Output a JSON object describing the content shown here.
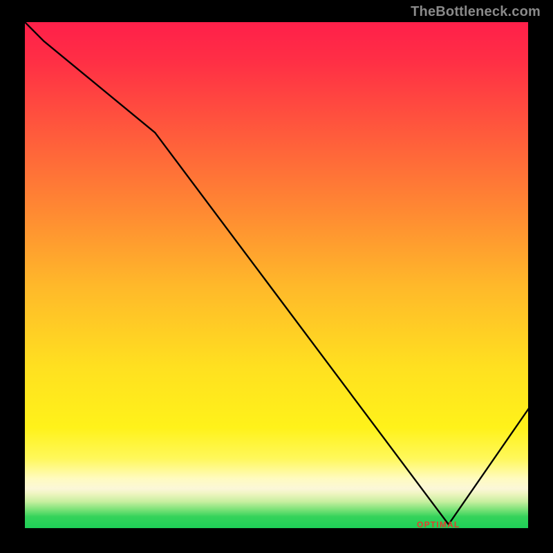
{
  "watermark": "TheBottleneck.com",
  "optimal_label": "OPTIMAL",
  "chart_data": {
    "type": "line",
    "title": "",
    "xlabel": "",
    "ylabel": "",
    "xlim": [
      0,
      100
    ],
    "ylim": [
      0,
      100
    ],
    "x": [
      0,
      4,
      26,
      84,
      100
    ],
    "y": [
      100,
      96,
      78,
      1,
      24
    ],
    "optimal_x": 82,
    "optimal_y": 1,
    "gradient_stops": [
      {
        "pos": 0,
        "color": "#ff1f4a"
      },
      {
        "pos": 22,
        "color": "#ff5a3c"
      },
      {
        "pos": 52,
        "color": "#ffb82a"
      },
      {
        "pos": 80,
        "color": "#fff21a"
      },
      {
        "pos": 92,
        "color": "#fbf7d8"
      },
      {
        "pos": 100,
        "color": "#1ccf57"
      }
    ]
  }
}
